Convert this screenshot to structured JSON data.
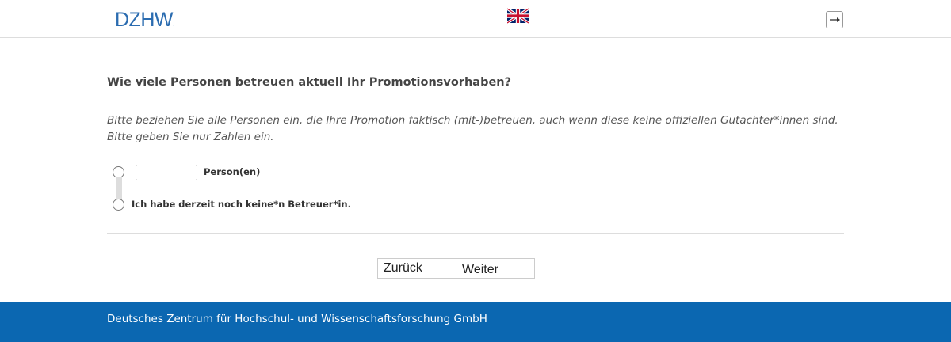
{
  "header": {
    "logo_text": "DZHW",
    "logo_dot": ".",
    "language_icon": "uk-flag-icon",
    "logout_icon": "logout-icon"
  },
  "question": {
    "title": "Wie viele Personen betreuen aktuell Ihr Promotionsvorhaben?",
    "instruction_line1": "Bitte beziehen Sie alle Personen ein, die Ihre Promotion faktisch (mit-)betreuen, auch wenn diese keine offiziellen Gutachter*innen sind.",
    "instruction_line2": "Bitte geben Sie nur Zahlen ein."
  },
  "options": {
    "persons_value": "",
    "persons_label": "Person(en)",
    "no_supervisor_label": "Ich habe derzeit noch keine*n Betreuer*in."
  },
  "navigation": {
    "back_label": "Zurück",
    "next_label": "Weiter"
  },
  "footer": {
    "text": "Deutsches Zentrum für Hochschul- und Wissenschaftsforschung GmbH"
  },
  "colors": {
    "brand_blue": "#0b67b1",
    "logo_blue": "#2b6cb0"
  }
}
